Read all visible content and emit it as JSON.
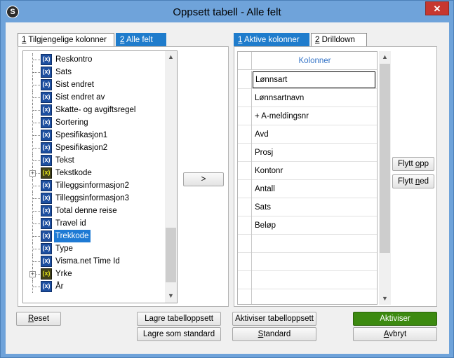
{
  "window": {
    "title": "Oppsett tabell - Alle felt",
    "close_label": "✕",
    "app_icon_glyph": "S"
  },
  "left_tabs": [
    {
      "key": "1",
      "label": " Tilgjengelige kolonner"
    },
    {
      "key": "2",
      "label": " Alle felt"
    }
  ],
  "right_tabs": [
    {
      "key": "1",
      "label": " Aktive kolonner"
    },
    {
      "key": "2",
      "label": " Drilldown"
    }
  ],
  "tree": {
    "items": [
      {
        "label": "Reskontro",
        "icon": "field-icon-blue",
        "glyph": "(x)"
      },
      {
        "label": "Sats",
        "icon": "field-icon-blue",
        "glyph": "(x)"
      },
      {
        "label": "Sist endret",
        "icon": "field-icon-blue",
        "glyph": "(x)"
      },
      {
        "label": "Sist endret av",
        "icon": "field-icon-blue",
        "glyph": "(x)"
      },
      {
        "label": "Skatte- og avgiftsregel",
        "icon": "field-icon-blue",
        "glyph": "(x)"
      },
      {
        "label": "Sortering",
        "icon": "field-icon-blue",
        "glyph": "(x)"
      },
      {
        "label": "Spesifikasjon1",
        "icon": "field-icon-blue",
        "glyph": "(x)"
      },
      {
        "label": "Spesifikasjon2",
        "icon": "field-icon-blue",
        "glyph": "(x)"
      },
      {
        "label": "Tekst",
        "icon": "field-icon-blue",
        "glyph": "(x)"
      },
      {
        "label": "Tekstkode",
        "icon": "field-icon-yellow",
        "glyph": "(x)",
        "expander": "+"
      },
      {
        "label": "Tilleggsinformasjon2",
        "icon": "field-icon-blue",
        "glyph": "(x)"
      },
      {
        "label": "Tilleggsinformasjon3",
        "icon": "field-icon-blue",
        "glyph": "(x)"
      },
      {
        "label": "Total denne reise",
        "icon": "field-icon-blue",
        "glyph": "(x)"
      },
      {
        "label": "Travel id",
        "icon": "field-icon-blue",
        "glyph": "(x)"
      },
      {
        "label": "Trekkode",
        "icon": "field-icon-blue",
        "glyph": "(x)",
        "selected": true
      },
      {
        "label": "Type",
        "icon": "field-icon-blue",
        "glyph": "(x)"
      },
      {
        "label": "Visma.net Time Id",
        "icon": "field-icon-blue",
        "glyph": "(x)"
      },
      {
        "label": "Yrke",
        "icon": "field-icon-yellow",
        "glyph": "(x)",
        "expander": "+"
      },
      {
        "label": "År",
        "icon": "field-icon-blue",
        "glyph": "(x)"
      }
    ]
  },
  "scroll": {
    "up_glyph": "▲",
    "down_glyph": "▼"
  },
  "move_right_label": ">",
  "columns_grid": {
    "header": "Kolonner",
    "rows": [
      "Lønnsart",
      "Lønnsartnavn",
      "+ A-meldingsnr",
      "Avd",
      "Prosj",
      "Kontonr",
      "Antall",
      "Sats",
      "Beløp",
      "",
      "",
      "",
      ""
    ]
  },
  "side_buttons": {
    "move_up_pre": "Flytt ",
    "move_up_key": "o",
    "move_up_post": "pp",
    "move_down_pre": "Flytt ",
    "move_down_key": "n",
    "move_down_post": "ed"
  },
  "footer": {
    "reset_key": "R",
    "reset_rest": "eset",
    "save_layout": "Lagre tabelloppsett",
    "save_as_default": "Lagre som standard",
    "activate_layout": "Aktiviser tabelloppsett",
    "standard_key": "S",
    "standard_rest": "tandard",
    "activate": "Aktiviser",
    "cancel_key": "A",
    "cancel_rest": "vbryt"
  }
}
